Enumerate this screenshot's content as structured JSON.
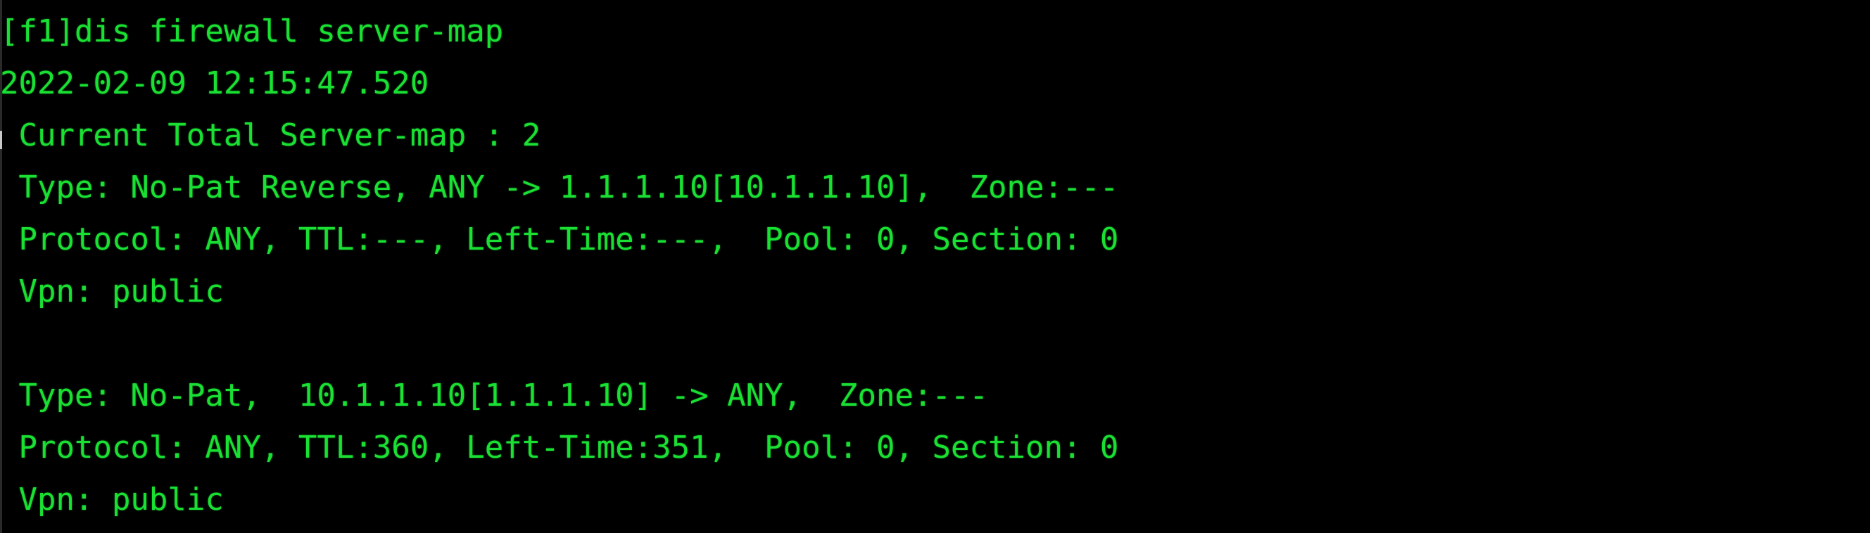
{
  "terminal": {
    "title": "firewall-console",
    "foreground_color": "#19e033",
    "background_color": "#000000",
    "border_color": "#2a2a2a",
    "border_highlight_color": "#c9c9c9",
    "prompt_tag": "[f1]",
    "command": "dis firewall server-map",
    "timestamp": "2022-02-09 12:15:47.520",
    "summary": " Current Total Server-map : 2",
    "lines": [
      "[f1]dis firewall server-map",
      "2022-02-09 12:15:47.520",
      " Current Total Server-map : 2",
      " Type: No-Pat Reverse, ANY -> 1.1.1.10[10.1.1.10],  Zone:---",
      " Protocol: ANY, TTL:---, Left-Time:---,  Pool: 0, Section: 0",
      " Vpn: public",
      " ",
      " Type: No-Pat,  10.1.1.10[1.1.1.10] -> ANY,  Zone:---",
      " Protocol: ANY, TTL:360, Left-Time:351,  Pool: 0, Section: 0",
      " Vpn: public"
    ],
    "server_map_entries": [
      {
        "type": "No-Pat Reverse",
        "mapping": "ANY -> 1.1.1.10[10.1.1.10]",
        "zone": "---",
        "protocol": "ANY",
        "ttl": "---",
        "left_time": "---",
        "pool": "0",
        "section": "0",
        "vpn": "public"
      },
      {
        "type": "No-Pat",
        "mapping": "10.1.1.10[1.1.1.10] -> ANY",
        "zone": "---",
        "protocol": "ANY",
        "ttl": "360",
        "left_time": "351",
        "pool": "0",
        "section": "0",
        "vpn": "public"
      }
    ]
  }
}
